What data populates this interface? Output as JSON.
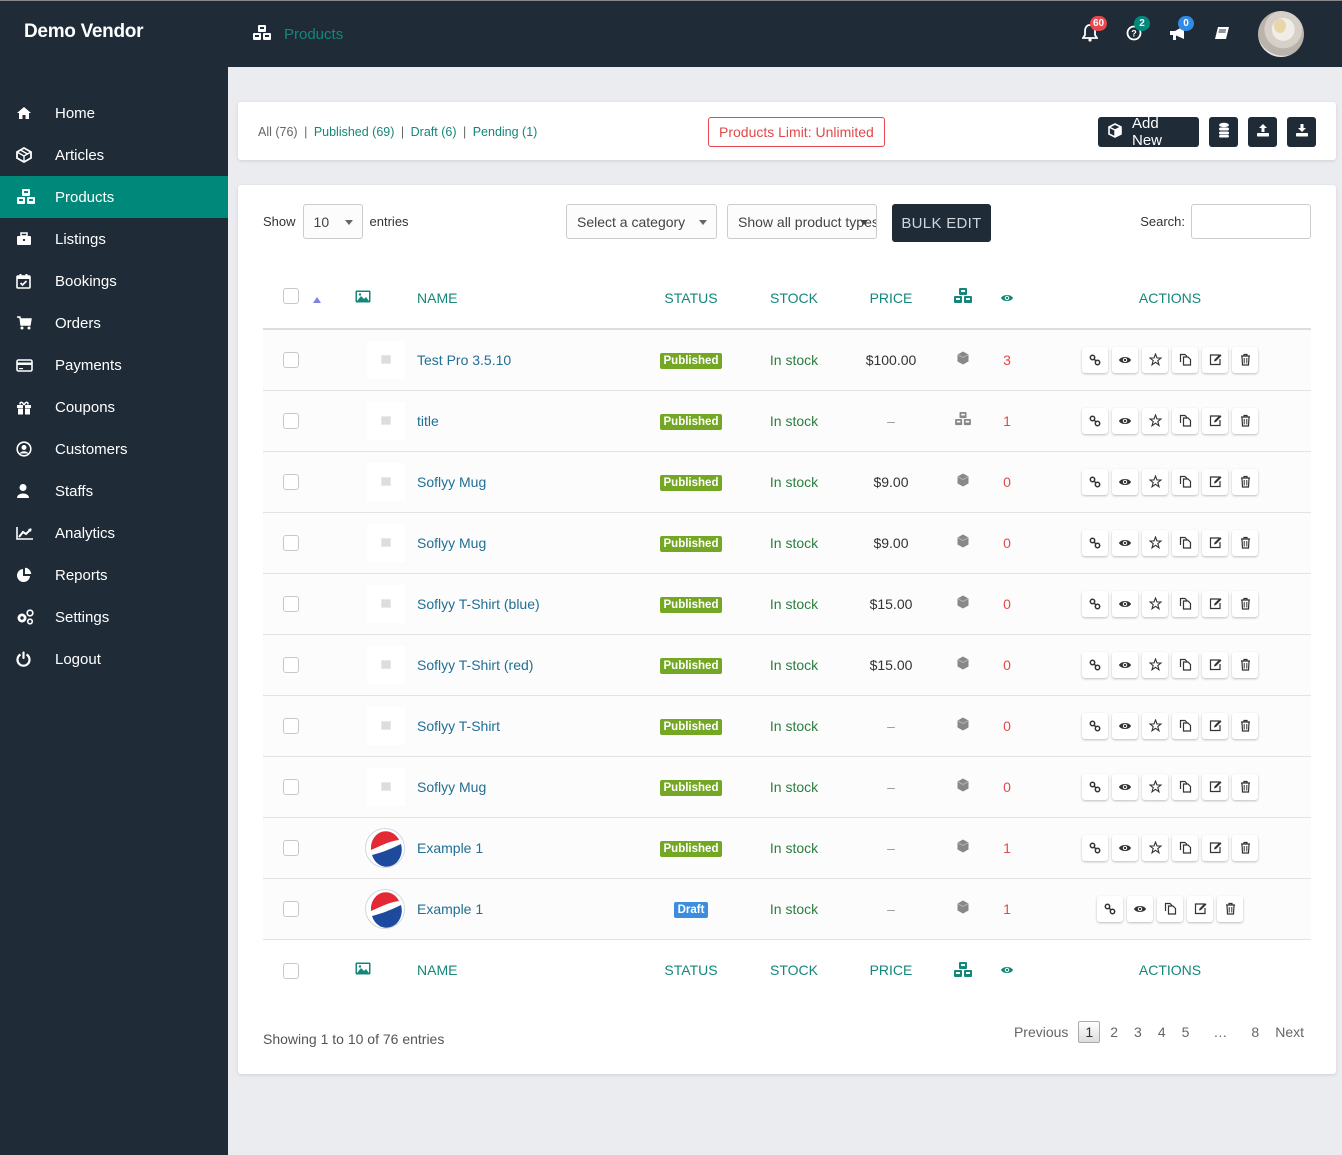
{
  "header": {
    "brand": "Demo Vendor",
    "page_title": "Products",
    "icons": [
      {
        "name": "notifications-bell-icon",
        "badge": "60",
        "badge_color": "#e5484d"
      },
      {
        "name": "help-question-icon",
        "badge": "2",
        "badge_color": "#00897b"
      },
      {
        "name": "announcements-megaphone-icon",
        "badge": "0",
        "badge_color": "#2f8be6"
      },
      {
        "name": "knowledgebase-book-icon",
        "badge": null
      }
    ]
  },
  "sidebar": {
    "active": "Products",
    "items": [
      {
        "label": "Home",
        "icon": "home-icon"
      },
      {
        "label": "Articles",
        "icon": "articles-icon"
      },
      {
        "label": "Products",
        "icon": "products-cubes-icon"
      },
      {
        "label": "Listings",
        "icon": "briefcase-icon"
      },
      {
        "label": "Bookings",
        "icon": "calendar-check-icon"
      },
      {
        "label": "Orders",
        "icon": "cart-icon"
      },
      {
        "label": "Payments",
        "icon": "credit-card-icon"
      },
      {
        "label": "Coupons",
        "icon": "gift-icon"
      },
      {
        "label": "Customers",
        "icon": "user-circle-icon"
      },
      {
        "label": "Staffs",
        "icon": "user-icon"
      },
      {
        "label": "Analytics",
        "icon": "line-chart-icon"
      },
      {
        "label": "Reports",
        "icon": "pie-chart-icon"
      },
      {
        "label": "Settings",
        "icon": "cogs-icon"
      },
      {
        "label": "Logout",
        "icon": "power-icon"
      }
    ]
  },
  "filters": {
    "all": "All (76)",
    "published": "Published (69)",
    "draft": "Draft (6)",
    "pending": "Pending (1)",
    "separator": "|"
  },
  "limit_text": "Products Limit: Unlimited",
  "toolbar": {
    "add_new": "Add New"
  },
  "table_controls": {
    "show_label": "Show",
    "entries_label": "entries",
    "length_value": "10",
    "category_placeholder": "Select a category",
    "product_type_placeholder": "Show all product types",
    "bulk_edit": "BULK EDIT",
    "search_label": "Search:",
    "search_value": ""
  },
  "columns": {
    "name": "NAME",
    "status": "STATUS",
    "stock": "STOCK",
    "price": "PRICE",
    "actions": "ACTIONS"
  },
  "status_colors": {
    "Published": "#73a724",
    "Draft": "#3c8dde"
  },
  "rows": [
    {
      "name": "Test Pro 3.5.10",
      "image": "placeholder",
      "status": "Published",
      "stock": "In stock",
      "price": "$100.00",
      "type": "simple",
      "views": "3",
      "actions": [
        "link",
        "view",
        "feature",
        "duplicate",
        "edit",
        "delete"
      ]
    },
    {
      "name": "title",
      "image": "placeholder",
      "status": "Published",
      "stock": "In stock",
      "price": "–",
      "type": "variable",
      "views": "1",
      "actions": [
        "link",
        "view",
        "feature",
        "duplicate",
        "edit",
        "delete"
      ]
    },
    {
      "name": "Soflyy Mug",
      "image": "placeholder",
      "status": "Published",
      "stock": "In stock",
      "price": "$9.00",
      "type": "simple",
      "views": "0",
      "actions": [
        "link",
        "view",
        "feature",
        "duplicate",
        "edit",
        "delete"
      ]
    },
    {
      "name": "Soflyy Mug",
      "image": "placeholder",
      "status": "Published",
      "stock": "In stock",
      "price": "$9.00",
      "type": "simple",
      "views": "0",
      "actions": [
        "link",
        "view",
        "feature",
        "duplicate",
        "edit",
        "delete"
      ]
    },
    {
      "name": "Soflyy T-Shirt (blue)",
      "image": "placeholder",
      "status": "Published",
      "stock": "In stock",
      "price": "$15.00",
      "type": "simple",
      "views": "0",
      "actions": [
        "link",
        "view",
        "feature",
        "duplicate",
        "edit",
        "delete"
      ]
    },
    {
      "name": "Soflyy T-Shirt (red)",
      "image": "placeholder",
      "status": "Published",
      "stock": "In stock",
      "price": "$15.00",
      "type": "simple",
      "views": "0",
      "actions": [
        "link",
        "view",
        "feature",
        "duplicate",
        "edit",
        "delete"
      ]
    },
    {
      "name": "Soflyy T-Shirt",
      "image": "placeholder",
      "status": "Published",
      "stock": "In stock",
      "price": "–",
      "type": "simple",
      "views": "0",
      "actions": [
        "link",
        "view",
        "feature",
        "duplicate",
        "edit",
        "delete"
      ]
    },
    {
      "name": "Soflyy Mug",
      "image": "placeholder",
      "status": "Published",
      "stock": "In stock",
      "price": "–",
      "type": "simple",
      "views": "0",
      "actions": [
        "link",
        "view",
        "feature",
        "duplicate",
        "edit",
        "delete"
      ]
    },
    {
      "name": "Example 1",
      "image": "pepsi-logo",
      "status": "Published",
      "stock": "In stock",
      "price": "–",
      "type": "simple",
      "views": "1",
      "actions": [
        "link",
        "view",
        "feature",
        "duplicate",
        "edit",
        "delete"
      ]
    },
    {
      "name": "Example 1",
      "image": "pepsi-logo",
      "status": "Draft",
      "stock": "In stock",
      "price": "–",
      "type": "simple",
      "views": "1",
      "actions": [
        "link",
        "view",
        "duplicate",
        "edit",
        "delete"
      ]
    }
  ],
  "footer": {
    "info": "Showing 1 to 10 of 76 entries",
    "previous": "Previous",
    "next": "Next",
    "pages": [
      "1",
      "2",
      "3",
      "4",
      "5",
      "…",
      "8"
    ],
    "current_page": "1"
  }
}
